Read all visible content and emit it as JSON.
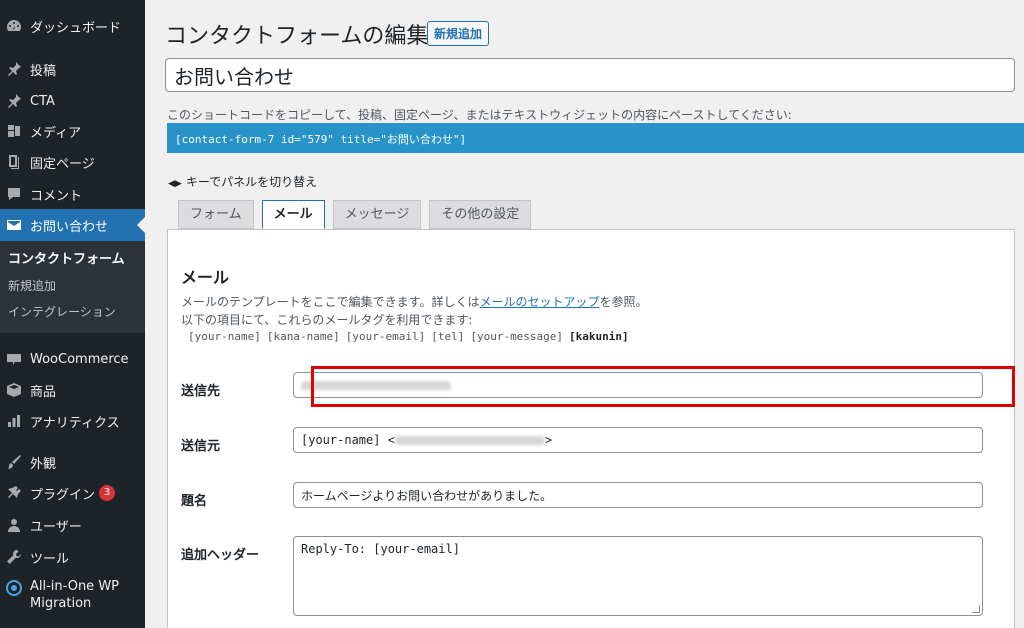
{
  "sidebar": {
    "items": [
      {
        "label": "ダッシュボード",
        "icon": "dashboard-icon"
      },
      {
        "label": "投稿",
        "icon": "pin-icon"
      },
      {
        "label": "CTA",
        "icon": "pin-icon"
      },
      {
        "label": "メディア",
        "icon": "media-icon"
      },
      {
        "label": "固定ページ",
        "icon": "page-icon"
      },
      {
        "label": "コメント",
        "icon": "comment-icon"
      },
      {
        "label": "お問い合わせ",
        "icon": "mail-icon"
      },
      {
        "label": "WooCommerce",
        "icon": "woo-icon"
      },
      {
        "label": "商品",
        "icon": "box-icon"
      },
      {
        "label": "アナリティクス",
        "icon": "bar-chart-icon"
      },
      {
        "label": "外観",
        "icon": "brush-icon"
      },
      {
        "label": "プラグイン",
        "icon": "plugin-icon",
        "badge": "3"
      },
      {
        "label": "ユーザー",
        "icon": "user-icon"
      },
      {
        "label": "ツール",
        "icon": "wrench-icon"
      },
      {
        "label": "All-in-One WP",
        "label2": "Migration",
        "icon": "migration-icon"
      }
    ],
    "submenu": [
      "コンタクトフォーム",
      "新規追加",
      "インテグレーション"
    ]
  },
  "main": {
    "title": "コンタクトフォームの編集",
    "add_new": "新規追加",
    "form_title": "お問い合わせ",
    "shortcode_desc": "このショートコードをコピーして、投稿、固定ページ、またはテキストウィジェットの内容にペーストしてください:",
    "shortcode": "[contact-form-7 id=\"579\" title=\"お問い合わせ\"]",
    "keyboard_hint": "キーでパネルを切り替え",
    "tabs": [
      "フォーム",
      "メール",
      "メッセージ",
      "その他の設定"
    ],
    "panel": {
      "heading": "メール",
      "desc1_before": "メールのテンプレートをここで編集できます。詳しくは",
      "desc1_link": "メールのセットアップ",
      "desc1_after": "を参照。",
      "desc2": "以下の項目にて、これらのメールタグを利用できます:",
      "mailtags": [
        "[your-name]",
        "[kana-name]",
        "[your-email]",
        "[tel]",
        "[your-message]"
      ],
      "mailtag_bold": "[kakunin]",
      "fields": {
        "to_label": "送信先",
        "from_label": "送信元",
        "from_value_prefix": "[your-name] <",
        "from_value_suffix": ">",
        "subject_label": "題名",
        "subject_value": "ホームページよりお問い合わせがありました。",
        "headers_label": "追加ヘッダー",
        "headers_value": "Reply-To: [your-email]"
      }
    }
  },
  "colors": {
    "sidebar_bg": "#1d2327",
    "accent": "#2271b1",
    "shortcode_bg": "#2793c9",
    "highlight": "#e00000"
  }
}
